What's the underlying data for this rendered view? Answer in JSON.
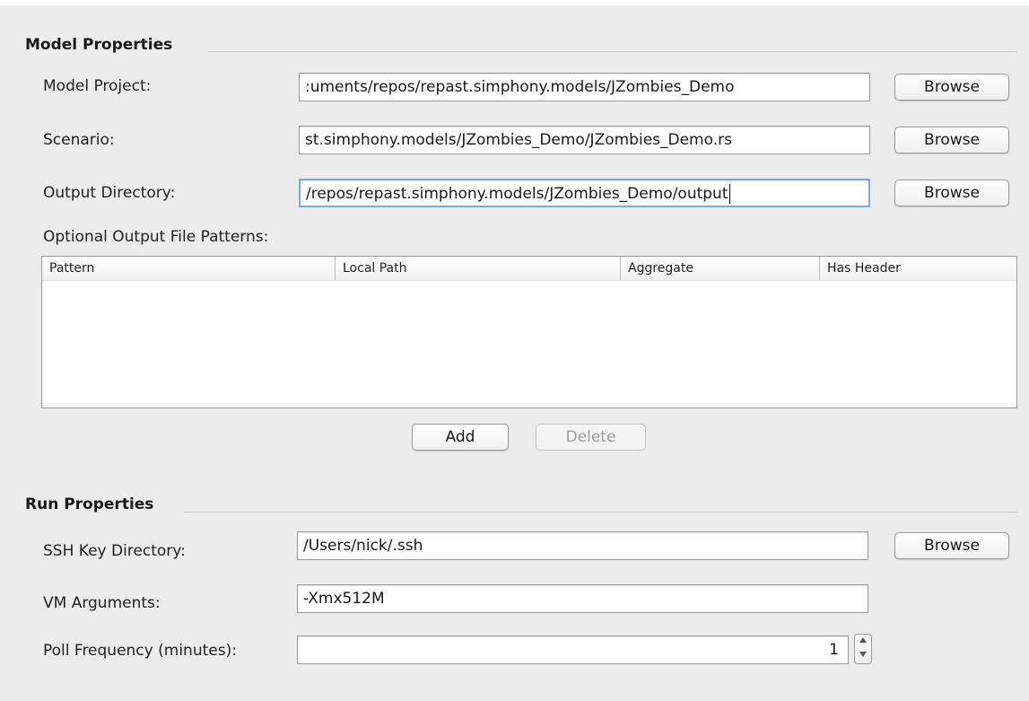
{
  "model_properties": {
    "title": "Model Properties",
    "model_project": {
      "label": "Model Project:",
      "value": ":uments/repos/repast.simphony.models/JZombies_Demo",
      "button": "Browse"
    },
    "scenario": {
      "label": "Scenario:",
      "value": "st.simphony.models/JZombies_Demo/JZombies_Demo.rs",
      "button": "Browse"
    },
    "output_directory": {
      "label": "Output Directory:",
      "value": "/repos/repast.simphony.models/JZombies_Demo/output",
      "button": "Browse"
    },
    "patterns": {
      "label": "Optional Output File Patterns:",
      "columns": [
        "Pattern",
        "Local Path",
        "Aggregate",
        "Has Header"
      ],
      "rows": [],
      "add_button": "Add",
      "delete_button": "Delete"
    }
  },
  "run_properties": {
    "title": "Run Properties",
    "ssh_key_directory": {
      "label": "SSH Key Directory:",
      "value": "/Users/nick/.ssh",
      "button": "Browse"
    },
    "vm_arguments": {
      "label": "VM Arguments:",
      "value": "-Xmx512M"
    },
    "poll_frequency": {
      "label": "Poll Frequency (minutes):",
      "value": "1",
      "stepper": {
        "up": "increment-arrow",
        "down": "decrement-arrow"
      }
    }
  }
}
